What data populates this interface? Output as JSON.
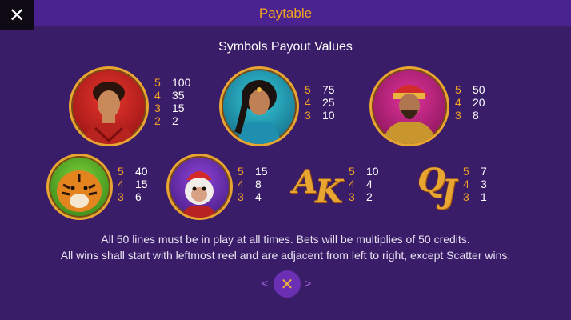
{
  "header": {
    "title": "Paytable",
    "close_glyph": "✕"
  },
  "content": {
    "subtitle": "Symbols Payout Values",
    "symbols": [
      {
        "name": "Aladdin",
        "payouts": [
          {
            "count": "5",
            "value": "100"
          },
          {
            "count": "4",
            "value": "35"
          },
          {
            "count": "3",
            "value": "15"
          },
          {
            "count": "2",
            "value": "2"
          }
        ]
      },
      {
        "name": "Jasmine",
        "payouts": [
          {
            "count": "5",
            "value": "75"
          },
          {
            "count": "4",
            "value": "25"
          },
          {
            "count": "3",
            "value": "10"
          }
        ]
      },
      {
        "name": "Sultan",
        "payouts": [
          {
            "count": "5",
            "value": "50"
          },
          {
            "count": "4",
            "value": "20"
          },
          {
            "count": "3",
            "value": "8"
          }
        ]
      },
      {
        "name": "Tiger",
        "payouts": [
          {
            "count": "5",
            "value": "40"
          },
          {
            "count": "4",
            "value": "15"
          },
          {
            "count": "3",
            "value": "6"
          }
        ]
      },
      {
        "name": "Monkey",
        "payouts": [
          {
            "count": "5",
            "value": "15"
          },
          {
            "count": "4",
            "value": "8"
          },
          {
            "count": "3",
            "value": "4"
          }
        ]
      },
      {
        "name": "AK",
        "letters": "AK",
        "payouts": [
          {
            "count": "5",
            "value": "10"
          },
          {
            "count": "4",
            "value": "4"
          },
          {
            "count": "3",
            "value": "2"
          }
        ]
      },
      {
        "name": "QJ",
        "letters": "QJ",
        "payouts": [
          {
            "count": "5",
            "value": "7"
          },
          {
            "count": "4",
            "value": "3"
          },
          {
            "count": "3",
            "value": "1"
          }
        ]
      }
    ],
    "rules_line1": "All 50 lines must be in play at all times. Bets will be multiplies of 50 credits.",
    "rules_line2": "All wins shall start with leftmost reel and are adjacent from left to right, except Scatter wins."
  },
  "nav": {
    "prev_glyph": "<",
    "next_glyph": ">",
    "close_glyph": "✕"
  },
  "colors": {
    "background": "#3a1d68",
    "header": "#4b2390",
    "accent_gold": "#f2a423",
    "text": "#ffffff"
  }
}
